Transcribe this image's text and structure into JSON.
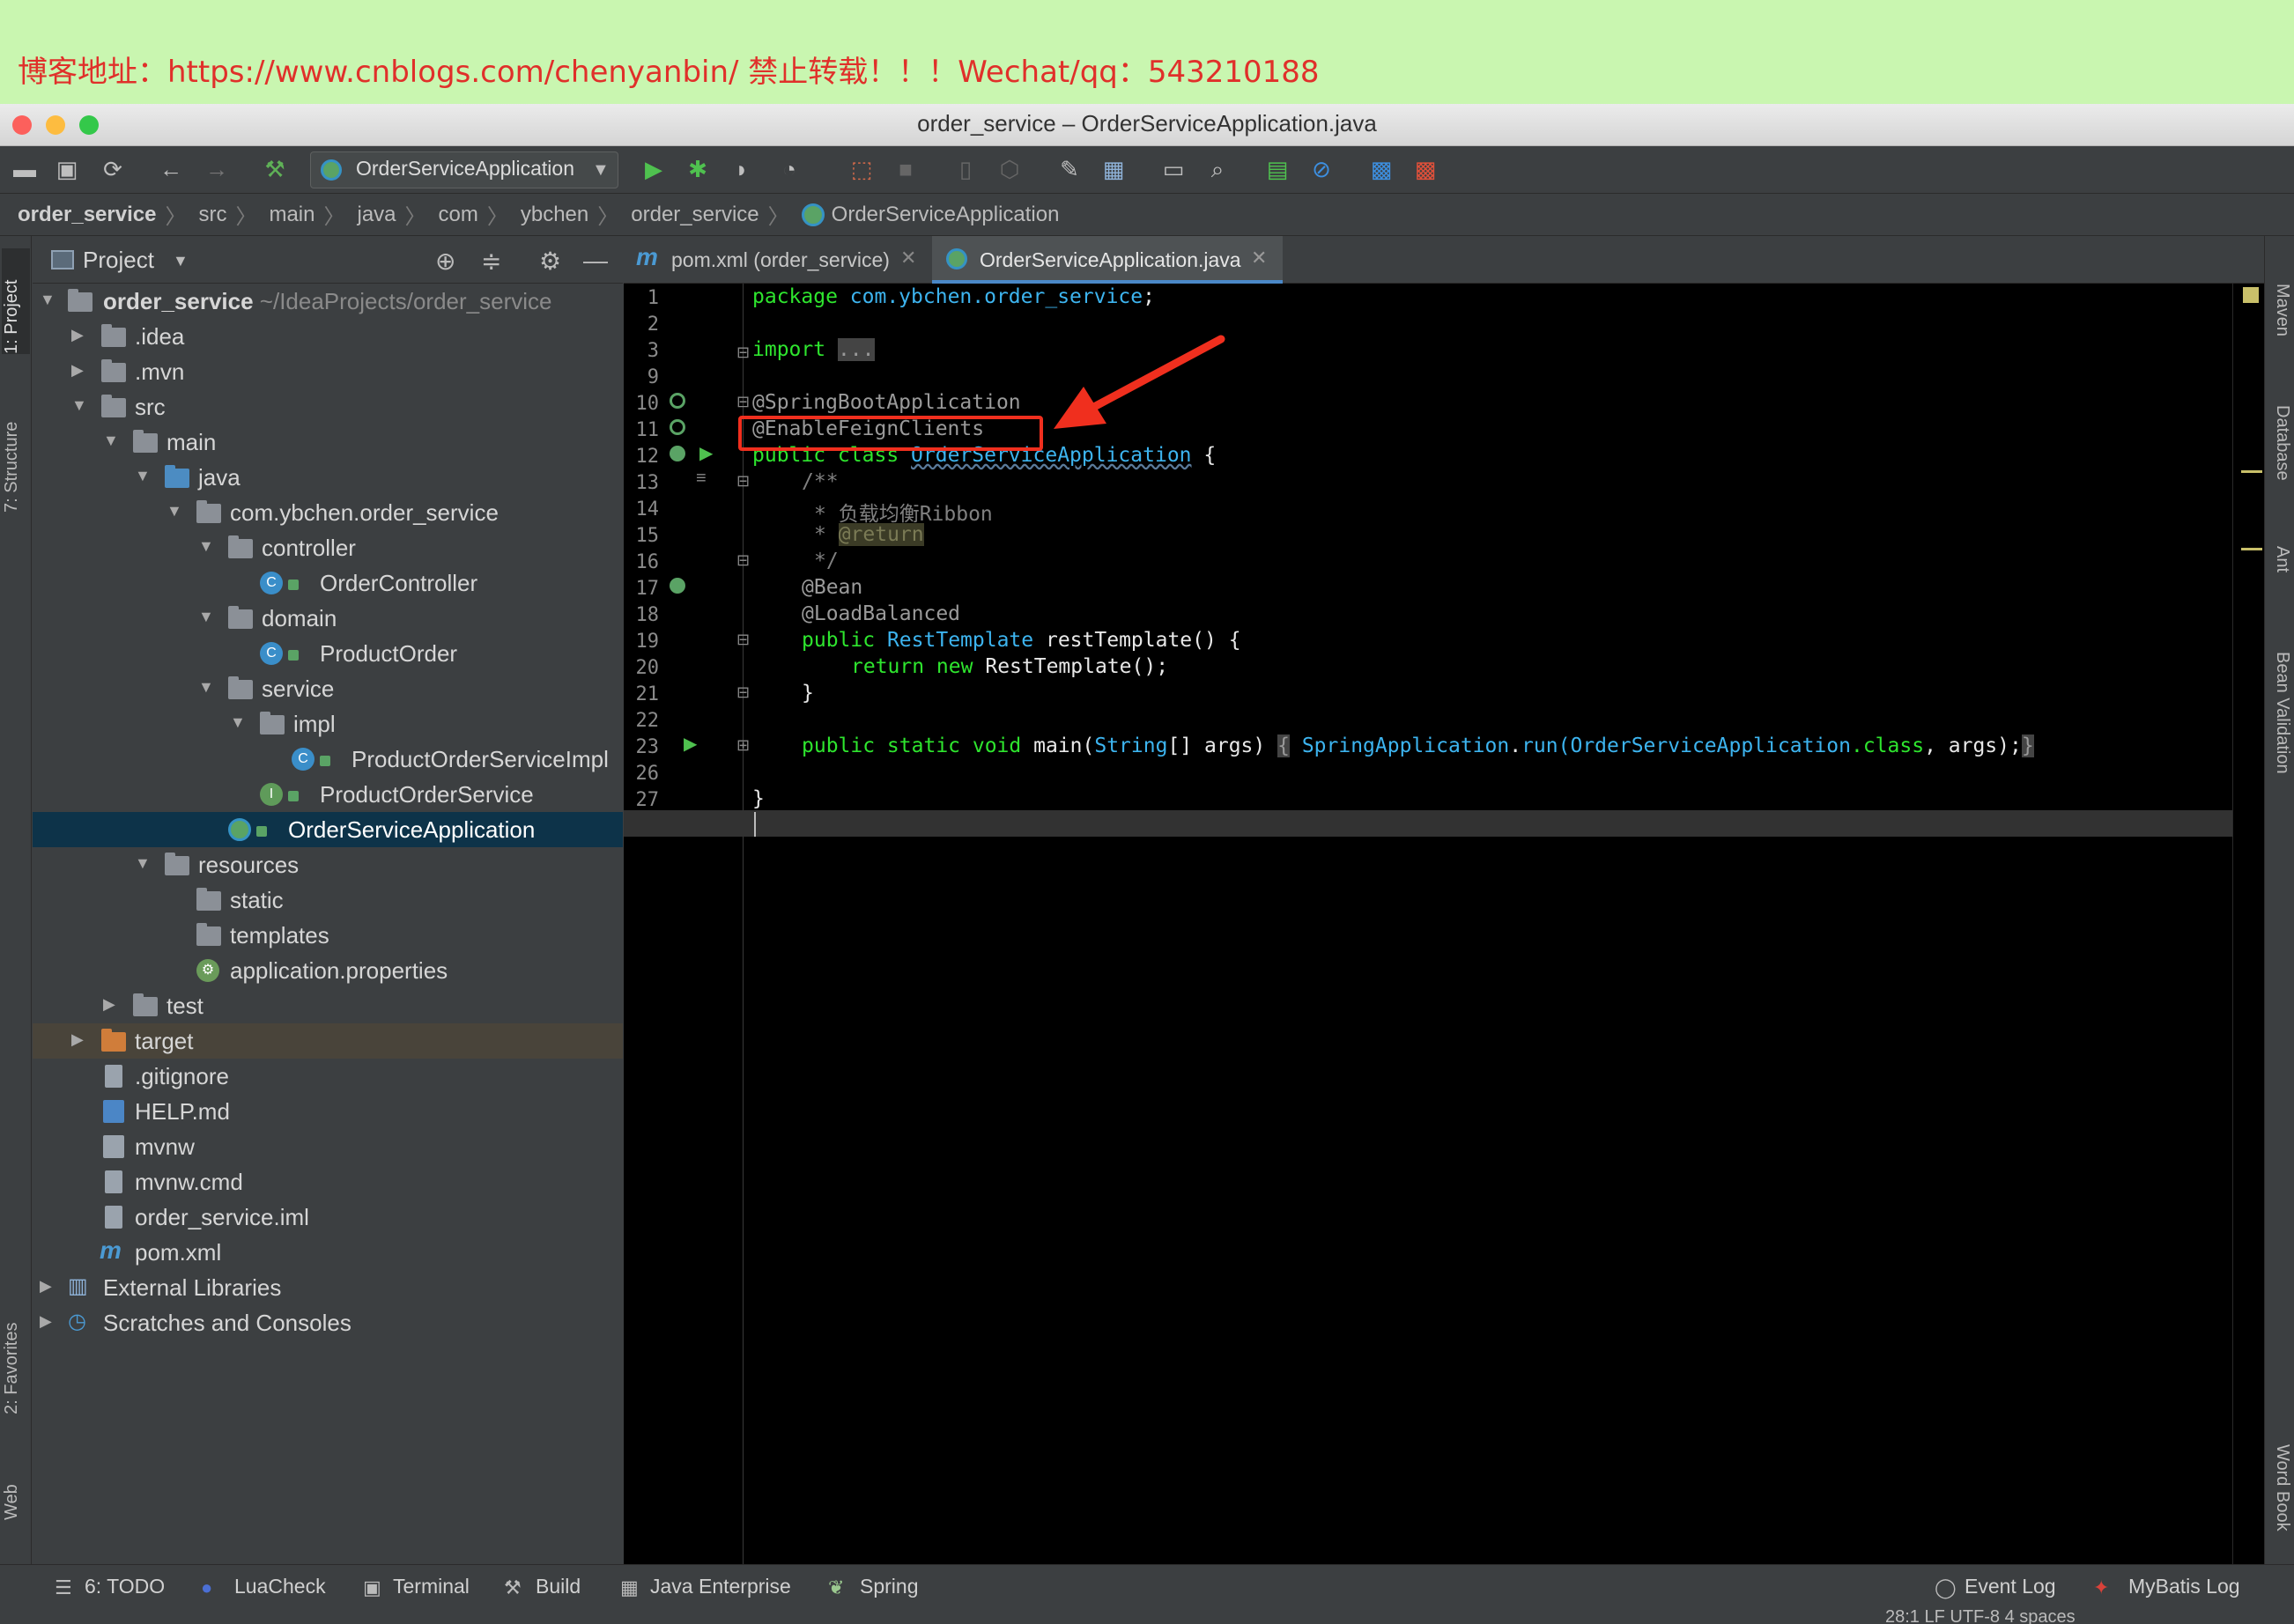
{
  "watermark": "博客地址：https://www.cnblogs.com/chenyanbin/        禁止转载！！！Wechat/qq：543210188",
  "window": {
    "title": "order_service – OrderServiceApplication.java"
  },
  "toolbar": {
    "run_config": "OrderServiceApplication"
  },
  "breadcrumb": [
    "order_service",
    "src",
    "main",
    "java",
    "com",
    "ybchen",
    "order_service",
    "OrderServiceApplication"
  ],
  "left_tabs": {
    "project": "1: Project",
    "structure": "7: Structure",
    "favorites": "2: Favorites",
    "web": "Web"
  },
  "right_tabs": {
    "maven": "Maven",
    "database": "Database",
    "ant": "Ant",
    "bean_validation": "Bean Validation",
    "word_book": "Word Book"
  },
  "project_panel": {
    "title": "Project",
    "tree": [
      {
        "label": "order_service",
        "sub": "~/IdeaProjects/order_service"
      },
      {
        "label": ".idea"
      },
      {
        "label": ".mvn"
      },
      {
        "label": "src"
      },
      {
        "label": "main"
      },
      {
        "label": "java"
      },
      {
        "label": "com.ybchen.order_service"
      },
      {
        "label": "controller"
      },
      {
        "label": "OrderController"
      },
      {
        "label": "domain"
      },
      {
        "label": "ProductOrder"
      },
      {
        "label": "service"
      },
      {
        "label": "impl"
      },
      {
        "label": "ProductOrderServiceImpl"
      },
      {
        "label": "ProductOrderService"
      },
      {
        "label": "OrderServiceApplication"
      },
      {
        "label": "resources"
      },
      {
        "label": "static"
      },
      {
        "label": "templates"
      },
      {
        "label": "application.properties"
      },
      {
        "label": "test"
      },
      {
        "label": "target"
      },
      {
        "label": ".gitignore"
      },
      {
        "label": "HELP.md"
      },
      {
        "label": "mvnw"
      },
      {
        "label": "mvnw.cmd"
      },
      {
        "label": "order_service.iml"
      },
      {
        "label": "pom.xml"
      },
      {
        "label": "External Libraries"
      },
      {
        "label": "Scratches and Consoles"
      }
    ]
  },
  "tabs": {
    "pom": "pom.xml (order_service)",
    "active": "OrderServiceApplication.java",
    "pom_icon": "m"
  },
  "editor": {
    "line_numbers": [
      "1",
      "2",
      "3",
      "9",
      "10",
      "11",
      "12",
      "13",
      "14",
      "15",
      "16",
      "17",
      "18",
      "19",
      "20",
      "21",
      "22",
      "23",
      "26",
      "27"
    ],
    "code": {
      "l1_kw": "package",
      "l1_pkg": "com.ybchen.order_service",
      "l1_end": ";",
      "l3_kw": "import",
      "l3_fold": "...",
      "l10": "@SpringBootApplication",
      "l11": "@EnableFeignClients",
      "l12_kw": "public class",
      "l12_cls": "OrderServiceApplication",
      "l12_end": "{",
      "l13": "/**",
      "l14": "* 负载均衡Ribbon",
      "l15_star": "*",
      "l15_tag": "@return",
      "l16": "*/",
      "l17": "@Bean",
      "l18": "@LoadBalanced",
      "l19_kw": "public",
      "l19_cls": "RestTemplate",
      "l19_rest": "restTemplate() {",
      "l20_kw": "return new",
      "l20_rest": "RestTemplate();",
      "l21": "}",
      "l23_kw": "public static void",
      "l23_main": "main(",
      "l23_str": "String",
      "l23_args": "[] args)",
      "l23_fold1": "{",
      "l23_spring": "SpringApplication",
      "l23_dot": ".",
      "l23_run": "run(",
      "l23_osa": "OrderServiceApplication",
      "l23_class": ".class",
      "l23_tail": ", args);",
      "l23_fold2": "}",
      "l27": "}"
    }
  },
  "bottom_tabs": {
    "todo": "6: TODO",
    "luacheck": "LuaCheck",
    "terminal": "Terminal",
    "build": "Build",
    "java_enterprise": "Java Enterprise",
    "spring": "Spring",
    "event_log": "Event Log",
    "mybatis_log": "MyBatis Log"
  },
  "status": {
    "position": "28:1   LF   UTF-8   4 spaces"
  },
  "colors": {
    "annotation_box": "#f02f1e",
    "keyword": "#2ee52e",
    "identifier": "#3db4ef",
    "selection": "#0d3349"
  }
}
